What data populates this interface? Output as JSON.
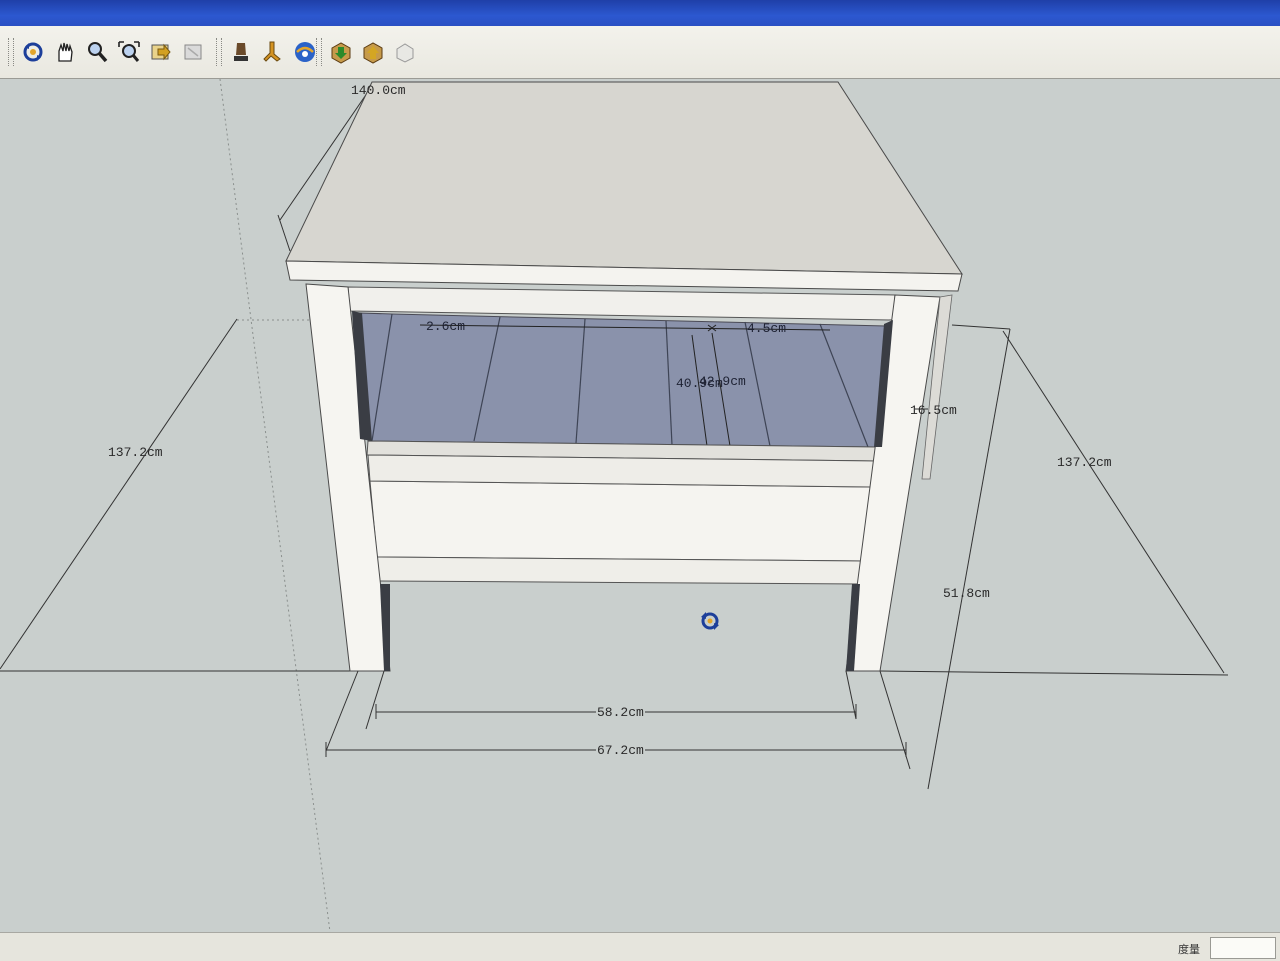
{
  "toolbar": {
    "tools": [
      {
        "name": "orbit-icon"
      },
      {
        "name": "pan-icon"
      },
      {
        "name": "zoom-icon"
      },
      {
        "name": "zoom-extents-icon"
      },
      {
        "name": "previous-view-icon"
      },
      {
        "name": "next-view-icon"
      },
      {
        "name": "position-camera-icon"
      },
      {
        "name": "walk-icon"
      },
      {
        "name": "look-around-icon"
      },
      {
        "name": "get-models-icon"
      },
      {
        "name": "share-model-icon"
      },
      {
        "name": "share-component-icon"
      }
    ]
  },
  "dimensions": {
    "top_depth": "140.0cm",
    "diagonal_left": "137.2cm",
    "diagonal_right": "137.2cm",
    "shelf_thickness": "2.6cm",
    "shelf_offset": "4.5cm",
    "inner_depth": "40.9cm",
    "inner_depth_overlap": "42.9cm",
    "side_height": "16.5cm",
    "total_height": "51.8cm",
    "inner_width": "58.2cm",
    "outer_width": "67.2cm"
  },
  "statusbar": {
    "measure_label": "度量",
    "measure_value": ""
  },
  "colors": {
    "title_blue": "#2c58d0",
    "viewport_bg": "#c9cfcd",
    "shelf_shadow": "#8a92ab",
    "furniture_white": "#f4f3ef"
  }
}
